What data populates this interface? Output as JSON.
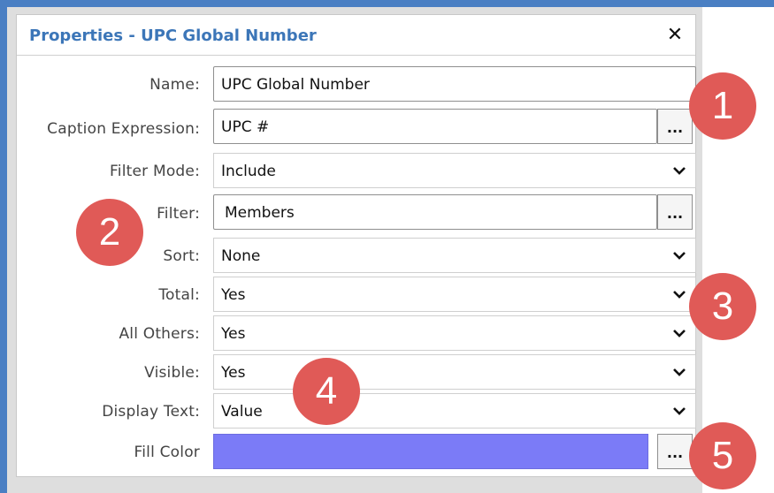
{
  "panel": {
    "title": "Properties - UPC Global Number",
    "close_glyph": "✕"
  },
  "fields": {
    "name": {
      "label": "Name:",
      "value": "UPC Global Number"
    },
    "caption_expression": {
      "label": "Caption Expression:",
      "value": "UPC #",
      "button": "..."
    },
    "filter_mode": {
      "label": "Filter Mode:",
      "value": "Include"
    },
    "filter": {
      "label": "Filter:",
      "value": "Members",
      "button": "..."
    },
    "sort": {
      "label": "Sort:",
      "value": "None"
    },
    "total": {
      "label": "Total:",
      "value": "Yes"
    },
    "all_others": {
      "label": "All Others:",
      "value": "Yes"
    },
    "visible": {
      "label": "Visible:",
      "value": "Yes"
    },
    "display_text": {
      "label": "Display Text:",
      "value": "Value"
    },
    "fill_color": {
      "label": "Fill Color",
      "color": "#7b7bf7",
      "button": "..."
    }
  },
  "callouts": [
    "1",
    "2",
    "3",
    "4",
    "5"
  ],
  "colors": {
    "accent": "#4a7fc3",
    "title": "#3c76b8",
    "callout": "#e05a57"
  }
}
